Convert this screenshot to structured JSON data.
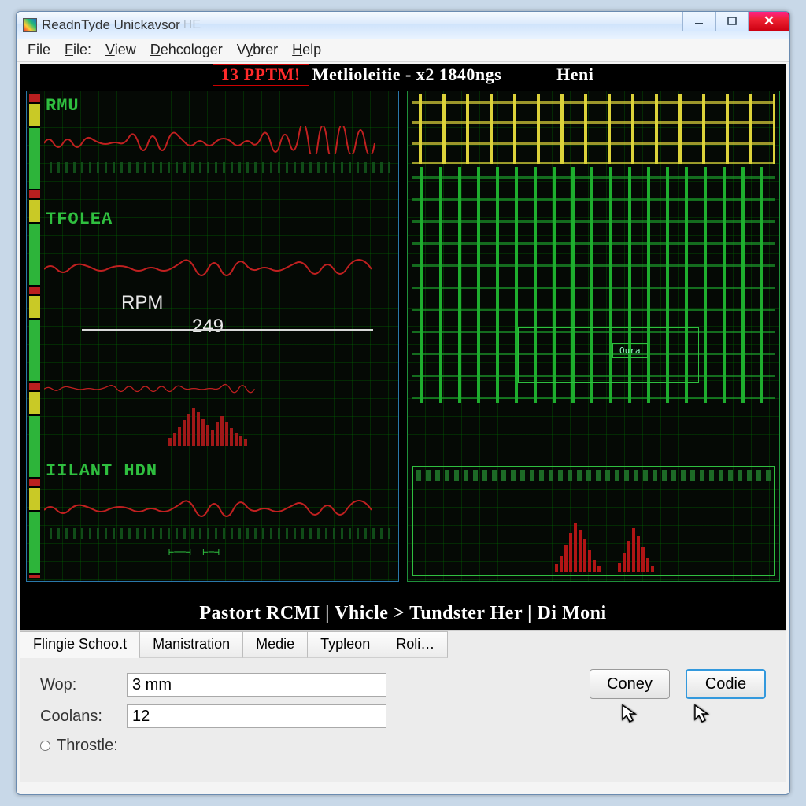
{
  "window": {
    "title": "ReadnTyde Unickavsor",
    "title_ghost": "HE"
  },
  "menu": {
    "file": "File",
    "file2": "File:",
    "view": "View",
    "dehcologer": "Dehcologer",
    "vybrer": "Vybrer",
    "help": "Help"
  },
  "workspace": {
    "warn": "13  PPTM!",
    "title": "Metlioleitie - x2 1840ngs",
    "heni": "Heni",
    "left_labels": {
      "l1": "RMU",
      "l2": "TFOLEA",
      "l3": "IILANT  HDN"
    },
    "rpm_label": "RPM",
    "rpm_value": "249",
    "right_box": "Oura",
    "breadcrumb": "Pastort  RCMI   |   Vhicle >  Tundster  Her  |   Di  Moni"
  },
  "tabs": {
    "t1": "Flingie Schoo.t",
    "t2": "Manistration",
    "t3": "Medie",
    "t4": "Typleon",
    "t5": "Roli…"
  },
  "form": {
    "wop_label": "Wop:",
    "wop_value": "3 mm",
    "coolans_label": "Coolans:",
    "coolans_value": "12",
    "throstle_label": "Throstle:"
  },
  "buttons": {
    "coney": "Coney",
    "codie": "Codie"
  },
  "colors": {
    "accent_green": "#2fbf3f",
    "accent_red": "#c02020",
    "accent_yellow": "#dcd23a"
  }
}
